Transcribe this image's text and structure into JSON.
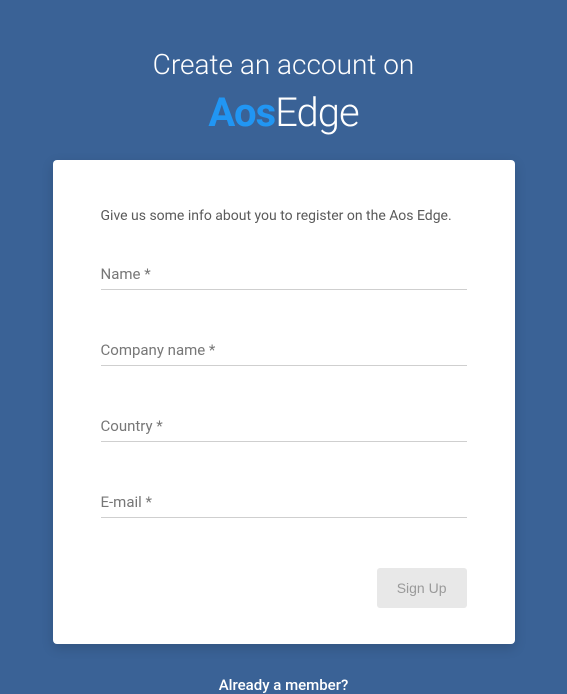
{
  "header": {
    "title": "Create an account on",
    "logo_part1": "Aos",
    "logo_part2": "Edge"
  },
  "card": {
    "intro": "Give us some info about you to register on the Aos Edge.",
    "fields": {
      "name_label": "Name *",
      "company_label": "Company name *",
      "country_label": "Country *",
      "email_label": "E-mail *"
    },
    "signup_label": "Sign Up"
  },
  "footer": {
    "already_member": "Already a member?"
  }
}
